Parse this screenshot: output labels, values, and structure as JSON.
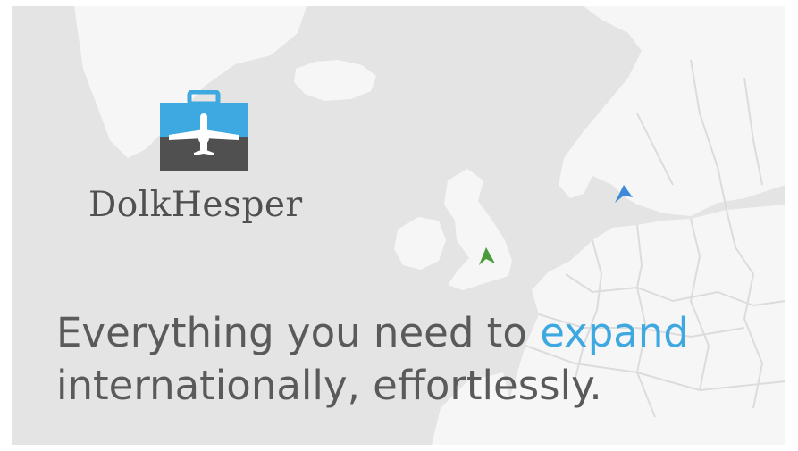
{
  "brand": {
    "name": "DolkHesper",
    "logo": "briefcase-airplane-icon"
  },
  "headline": {
    "line1_prefix": "Everything you need to",
    "line1_accent": "expand",
    "line2": "internationally, effortlessly."
  },
  "markers": [
    {
      "icon": "plane-marker-icon",
      "color": "#4a9a3a"
    },
    {
      "icon": "plane-marker-icon",
      "color": "#3d8ad8"
    }
  ],
  "colors": {
    "background": "#e4e4e4",
    "land": "#f6f6f6",
    "accent": "#3ea9e0",
    "briefcase_top": "#3ea9e0",
    "briefcase_bottom": "#505050",
    "text": "#5a5a5a"
  }
}
